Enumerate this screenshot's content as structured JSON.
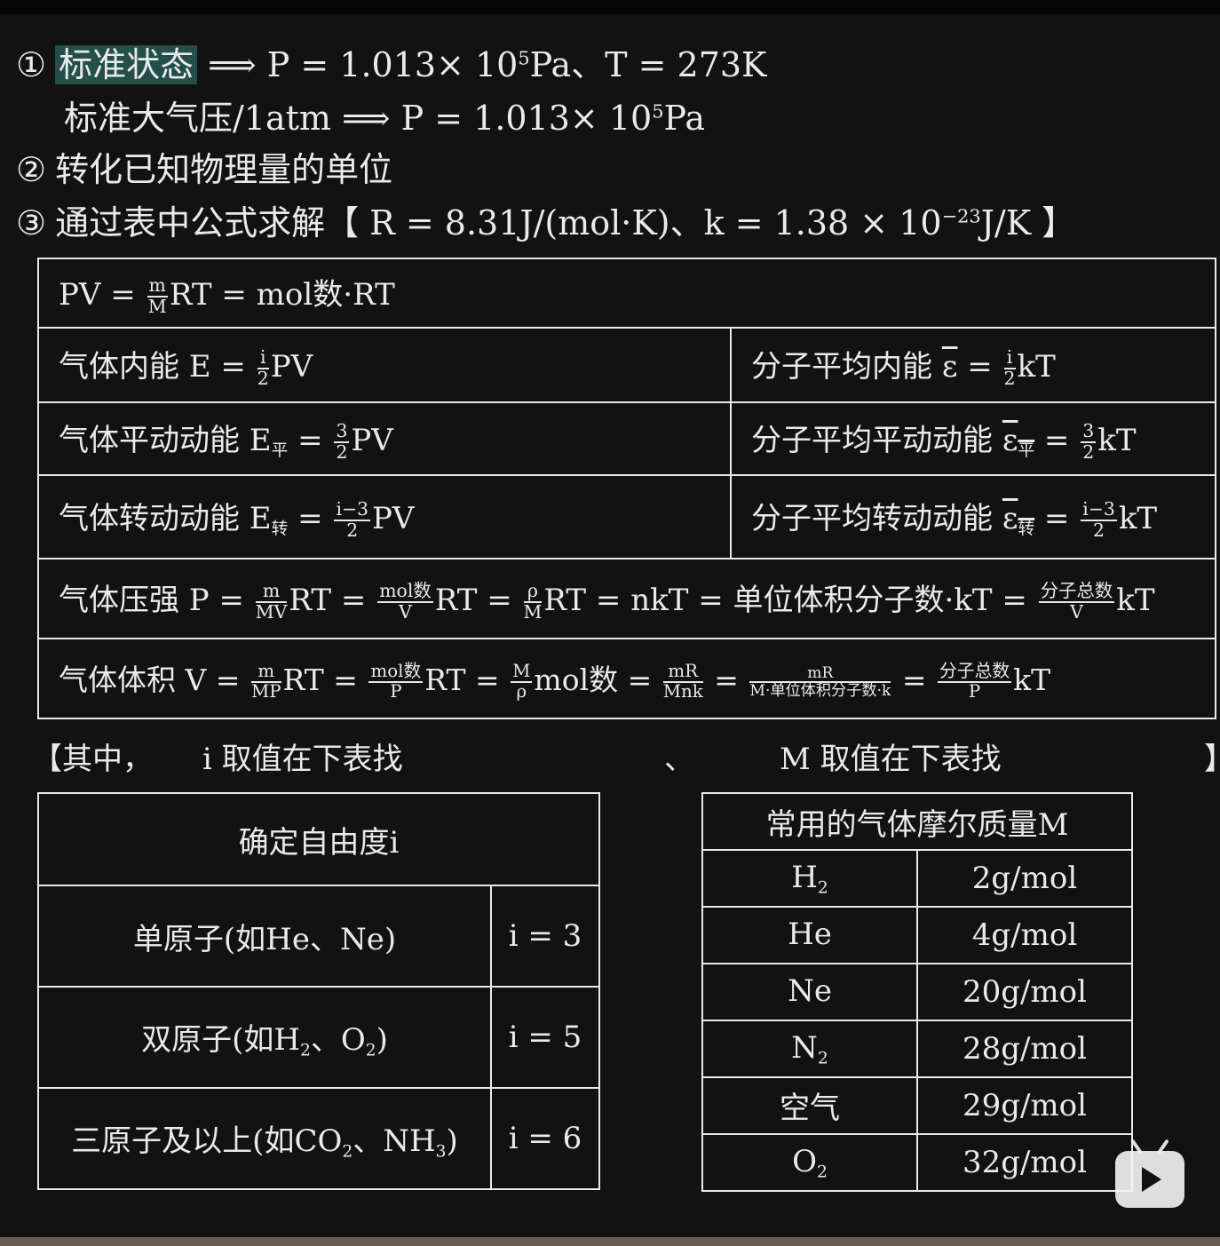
{
  "header": {
    "l1": {
      "num": "①",
      "hl": "标准状态",
      "rest": " ⟹  P = 1.013× 10",
      "exp": "5",
      "tail": "Pa、T = 273K"
    },
    "l2": {
      "text": "标准大气压/1atm  ⟹  P = 1.013× 10",
      "exp": "5",
      "tail": "Pa"
    },
    "l3": {
      "num": "②",
      "text": "转化已知物理量的单位"
    },
    "l4": {
      "num": "③",
      "text": "通过表中公式求解【 R = 8.31J/(mol·K)、k = 1.38 × 10",
      "exp": "−23",
      "tail": "J/K 】"
    }
  },
  "formulas": {
    "row0": {
      "a": "PV = ",
      "fn": "m",
      "fd": "M",
      "b": "RT = mol数·RT"
    },
    "row1": {
      "left": {
        "a": "气体内能 E = ",
        "fn": "i",
        "fd": "2",
        "b": "PV"
      },
      "right": {
        "a": "分子平均内能 ",
        "eps": "ε",
        "eq": " = ",
        "fn": "i",
        "fd": "2",
        "b": "kT"
      }
    },
    "row2": {
      "left": {
        "a": "气体平动动能 E",
        "sub": "平",
        "eq": " = ",
        "fn": "3",
        "fd": "2",
        "b": "PV"
      },
      "right": {
        "a": "分子平均平动动能 ",
        "eps": "ε",
        "sub": "平",
        "eq": " = ",
        "fn": "3",
        "fd": "2",
        "b": "kT"
      }
    },
    "row3": {
      "left": {
        "a": "气体转动动能 E",
        "sub": "转",
        "eq": " = ",
        "fn": "i−3",
        "fd": "2",
        "b": "PV"
      },
      "right": {
        "a": "分子平均转动动能 ",
        "eps": "ε",
        "sub": "转",
        "eq": " = ",
        "fn": "i−3",
        "fd": "2",
        "b": "kT"
      }
    },
    "row4": {
      "a": "气体压强 P = ",
      "f1n": "m",
      "f1d": "MV",
      "b": "RT = ",
      "f2n": "mol数",
      "f2d": "V",
      "c": "RT = ",
      "f3n": "ρ",
      "f3d": "M",
      "d": "RT  = nkT = 单位体积分子数·kT = ",
      "f4n": "分子总数",
      "f4d": "V",
      "e": "kT"
    },
    "row5": {
      "a": "气体体积 V = ",
      "f1n": "m",
      "f1d": "MP",
      "b": "RT = ",
      "f2n": "mol数",
      "f2d": "P",
      "c": "RT = ",
      "f3n": "M",
      "f3d": "ρ",
      "d": "mol数 = ",
      "f4n": "mR",
      "f4d": "Mnk",
      "e": " = ",
      "f5n": "mR",
      "f5d": "M·单位体积分子数·k",
      "f": " = ",
      "f6n": "分子总数",
      "f6d": "P",
      "g": "kT"
    }
  },
  "note": {
    "open": "【其中，",
    "i_text": "i 取值在下表找",
    "sep": "、",
    "m_text": "M 取值在下表找",
    "close": "】"
  },
  "itable": {
    "header": "确定自由度i",
    "rows": [
      {
        "label": "单原子(如He、Ne)",
        "value": "i = 3"
      },
      {
        "label_a": "双原子(如H",
        "s1": "2",
        "label_b": "、O",
        "s2": "2",
        "label_c": ")",
        "value": "i = 5"
      },
      {
        "label_a": "三原子及以上(如CO",
        "s1": "2",
        "label_b": "、NH",
        "s2": "3",
        "label_c": ")",
        "value": "i = 6"
      }
    ]
  },
  "mtable": {
    "header": "常用的气体摩尔质量M",
    "rows": [
      {
        "gas": "H",
        "sub": "2",
        "mass": "2g/mol"
      },
      {
        "gas": "He",
        "sub": "",
        "mass": "4g/mol"
      },
      {
        "gas": "Ne",
        "sub": "",
        "mass": "20g/mol"
      },
      {
        "gas": "N",
        "sub": "2",
        "mass": "28g/mol"
      },
      {
        "gas": "空气",
        "sub": "",
        "mass": "29g/mol"
      },
      {
        "gas": "O",
        "sub": "2",
        "mass": "32g/mol"
      }
    ]
  },
  "icons": {
    "watermark": "bilibili-play-icon"
  },
  "colors": {
    "background": "#121212",
    "text": "#eaeaea",
    "highlight": "#244e49"
  }
}
